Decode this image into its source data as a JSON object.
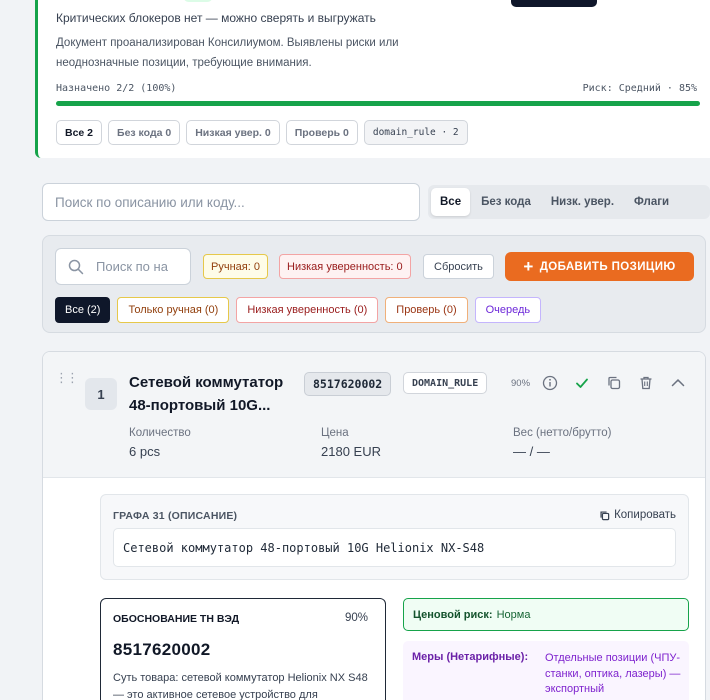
{
  "summary": {
    "line1": "Критических блокеров нет — можно сверять и выгружать",
    "line2": "Документ проанализирован Консилиумом. Выявлены риски или неоднозначные позиции, требующие внимания.",
    "assigned": "Назначено 2/2 (100%)",
    "risk": "Риск: Средний · 85%",
    "progress": 1.0,
    "chips": [
      "Все 2",
      "Без кода 0",
      "Низкая увер. 0",
      "Проверь 0"
    ],
    "rule_chip": "domain_rule · 2"
  },
  "search": {
    "placeholder": "Поиск по описанию или коду...",
    "tabs": [
      "Все",
      "Без кода",
      "Низк. увер.",
      "Флаги"
    ]
  },
  "filter": {
    "search_placeholder": "Поиск по на",
    "manual_badge": "Ручная: 0",
    "low_badge": "Низкая уверенность: 0",
    "reset": "Сбросить",
    "add_button": "ДОБАВИТЬ ПОЗИЦИЮ",
    "pills": {
      "all": "Все (2)",
      "manual": "Только ручная (0)",
      "low": "Низкая уверенность (0)",
      "check": "Проверь (0)",
      "queue": "Очередь"
    }
  },
  "item": {
    "number": "1",
    "title": "Сетевой коммутатор 48-портовый 10G...",
    "code": "8517620002",
    "rule": "DOMAIN_RULE",
    "confidence": "90%",
    "qty_label": "Количество",
    "qty_value": "6 pcs",
    "price_label": "Цена",
    "price_value": "2180 EUR",
    "weight_label": "Вес (нетто/брутто)",
    "weight_value": "— / —",
    "desc_title": "ГРАФА 31 (ОПИСАНИЕ)",
    "copy_label": "Копировать",
    "desc_text": "Сетевой коммутатор 48-портовый 10G Helionix NX-S48",
    "just_title": "ОБОСНОВАНИЕ ТН ВЭД",
    "just_pct": "90%",
    "just_code": "8517620002",
    "just_text": "Суть товара: сетевой коммутатор Helionix NX S48 — это активное сетевое устройство для",
    "price_risk_label": "Ценовой риск:",
    "price_risk_value": "Норма",
    "measures_label": "Меры (Нетарифные):",
    "measures_text": "Отдельные позиции (ЧПУ-станки, оптика, лазеры) — экспортный"
  },
  "colors": {
    "accent_green": "#16a34a",
    "add_orange": "#ea6b20",
    "dark": "#0f172a"
  }
}
